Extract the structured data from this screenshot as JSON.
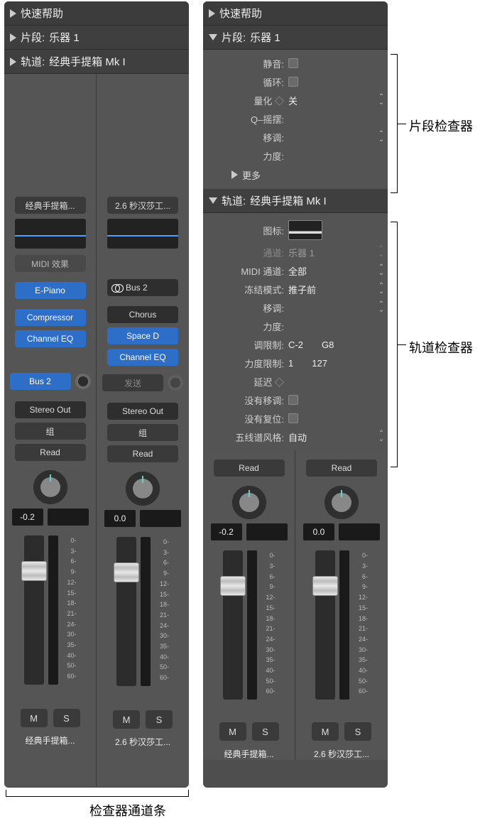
{
  "left": {
    "quickHelp": "快速帮助",
    "region": {
      "prefix": "片段:",
      "name": "乐器 1"
    },
    "track": {
      "prefix": "轨道:",
      "name": "经典手提箱 Mk I"
    },
    "strips": [
      {
        "title": "经典手提箱...",
        "midiFx": "MIDI 效果",
        "instrument": "E-Piano",
        "fx": [
          "Compressor",
          "Channel EQ"
        ],
        "sendLabel": "Bus 2",
        "output": "Stereo Out",
        "group": "组",
        "auto": "Read",
        "value": "-0.2",
        "mute": "M",
        "solo": "S",
        "name": "经典手提箱..."
      },
      {
        "title": "2.6 秒汉莎工...",
        "instrument": "Bus 2",
        "fx": [
          "Chorus",
          "Space D",
          "Channel EQ"
        ],
        "sendLabel": "发送",
        "output": "Stereo Out",
        "group": "组",
        "auto": "Read",
        "value": "0.0",
        "mute": "M",
        "solo": "S",
        "name": "2.6 秒汉莎工..."
      }
    ]
  },
  "right": {
    "quickHelp": "快速帮助",
    "region": {
      "prefix": "片段:",
      "name": "乐器 1"
    },
    "regionParams": {
      "mute": "静音:",
      "loop": "循环:",
      "quantizeLabel": "量化",
      "quantizeValue": "关",
      "qswing": "Q–摇摆:",
      "transpose": "移调:",
      "velocity": "力度:",
      "more": "更多"
    },
    "track": {
      "prefix": "轨道:",
      "name": "经典手提箱 Mk I"
    },
    "trackParams": {
      "iconLabel": "图标:",
      "channelLabel": "通道:",
      "channelValue": "乐器 1",
      "midiChLabel": "MIDI 通道:",
      "midiChValue": "全部",
      "freezeLabel": "冻结模式:",
      "freezeValue": "推子前",
      "transposeLabel": "移调:",
      "velocityLabel": "力度:",
      "keyLimitLabel": "调限制:",
      "keyLimitLow": "C-2",
      "keyLimitHigh": "G8",
      "velLimitLabel": "力度限制:",
      "velLimitLow": "1",
      "velLimitHigh": "127",
      "delayLabel": "延迟",
      "noTransLabel": "没有移调:",
      "noResetLabel": "没有复位:",
      "staffLabel": "五线谱风格:",
      "staffValue": "自动"
    },
    "strips": [
      {
        "auto": "Read",
        "value": "-0.2",
        "mute": "M",
        "solo": "S",
        "name": "经典手提箱..."
      },
      {
        "auto": "Read",
        "value": "0.0",
        "mute": "M",
        "solo": "S",
        "name": "2.6 秒汉莎工..."
      }
    ]
  },
  "scale": [
    "0-",
    "3-",
    "6-",
    "9-",
    "12-",
    "15-",
    "18-",
    "21-",
    "24-",
    "30-",
    "35-",
    "40-",
    "50-",
    "60-"
  ],
  "annot": {
    "regionInspector": "片段检查器",
    "trackInspector": "轨道检查器",
    "channelStrips": "检查器通道条"
  }
}
